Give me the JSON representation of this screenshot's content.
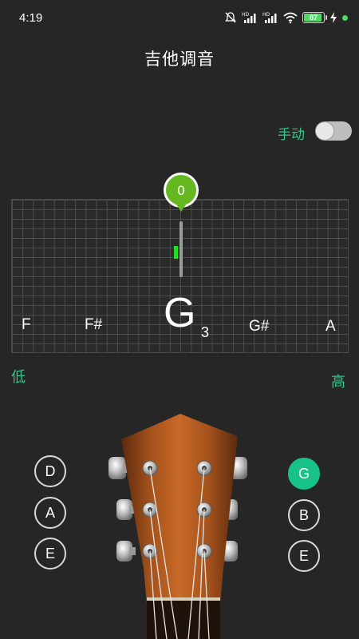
{
  "status_bar": {
    "time": "4:19",
    "battery": "87",
    "icons": [
      "mute-bell-icon",
      "hd-signal-icon",
      "hd-signal-icon",
      "wifi-icon",
      "battery-icon",
      "charging-icon",
      "dot-icon"
    ]
  },
  "header": {
    "title": "吉他调音"
  },
  "mode": {
    "label": "手动",
    "toggle_on": false
  },
  "tuner": {
    "cents": "0",
    "notes": {
      "left2": "F",
      "left1": "F#",
      "current": "G",
      "octave": "3",
      "right1": "G#",
      "right2": "A"
    },
    "low_label": "低",
    "high_label": "高",
    "indicator_color": "#22dd22",
    "bubble_color": "#66b821"
  },
  "strings": {
    "left": [
      "D",
      "A",
      "E"
    ],
    "right": [
      "G",
      "B",
      "E"
    ],
    "selected": "G",
    "accent": "#16c287"
  }
}
